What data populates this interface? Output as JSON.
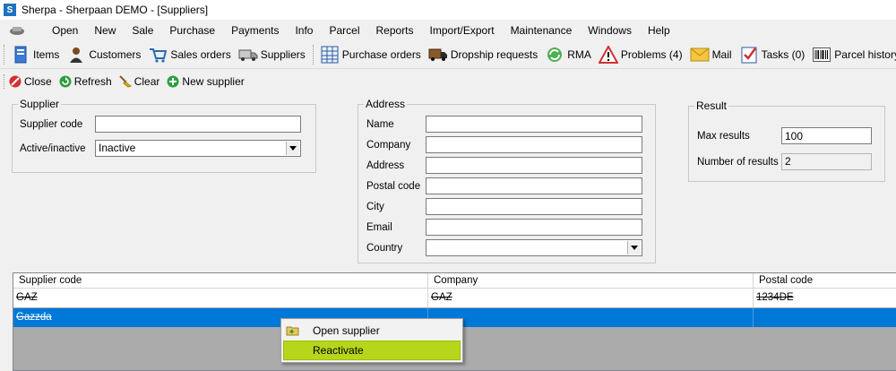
{
  "window": {
    "title": "Sherpa - Sherpaan DEMO - [Suppliers]",
    "app_icon_letter": "S"
  },
  "menu": [
    "Open",
    "New",
    "Sale",
    "Purchase",
    "Payments",
    "Info",
    "Parcel",
    "Reports",
    "Import/Export",
    "Maintenance",
    "Windows",
    "Help"
  ],
  "toolbar": {
    "items": "Items",
    "customers": "Customers",
    "sales_orders": "Sales orders",
    "suppliers": "Suppliers",
    "purchase_orders": "Purchase orders",
    "dropship": "Dropship requests",
    "rma": "RMA",
    "problems": "Problems (4)",
    "mail": "Mail",
    "tasks": "Tasks (0)",
    "parcel_history": "Parcel history"
  },
  "actions": {
    "close": "Close",
    "refresh": "Refresh",
    "clear": "Clear",
    "new_supplier": "New supplier"
  },
  "supplier": {
    "legend": "Supplier",
    "code_label": "Supplier code",
    "code_value": "",
    "active_label": "Active/inactive",
    "active_value": "Inactive"
  },
  "address": {
    "legend": "Address",
    "name_label": "Name",
    "company_label": "Company",
    "address_label": "Address",
    "postal_label": "Postal code",
    "city_label": "City",
    "email_label": "Email",
    "country_label": "Country"
  },
  "result": {
    "legend": "Result",
    "max_label": "Max results",
    "max_value": "100",
    "count_label": "Number of results",
    "count_value": "2"
  },
  "grid": {
    "headers": [
      "Supplier code",
      "Company",
      "Postal code"
    ],
    "rows": [
      [
        "GAZ",
        "GAZ",
        "1234DE"
      ],
      [
        "Gazzda",
        "",
        ""
      ]
    ]
  },
  "context_menu": {
    "open": "Open supplier",
    "reactivate": "Reactivate"
  },
  "colors": {
    "selection": "#0078d7",
    "highlight": "#b5d61a"
  }
}
